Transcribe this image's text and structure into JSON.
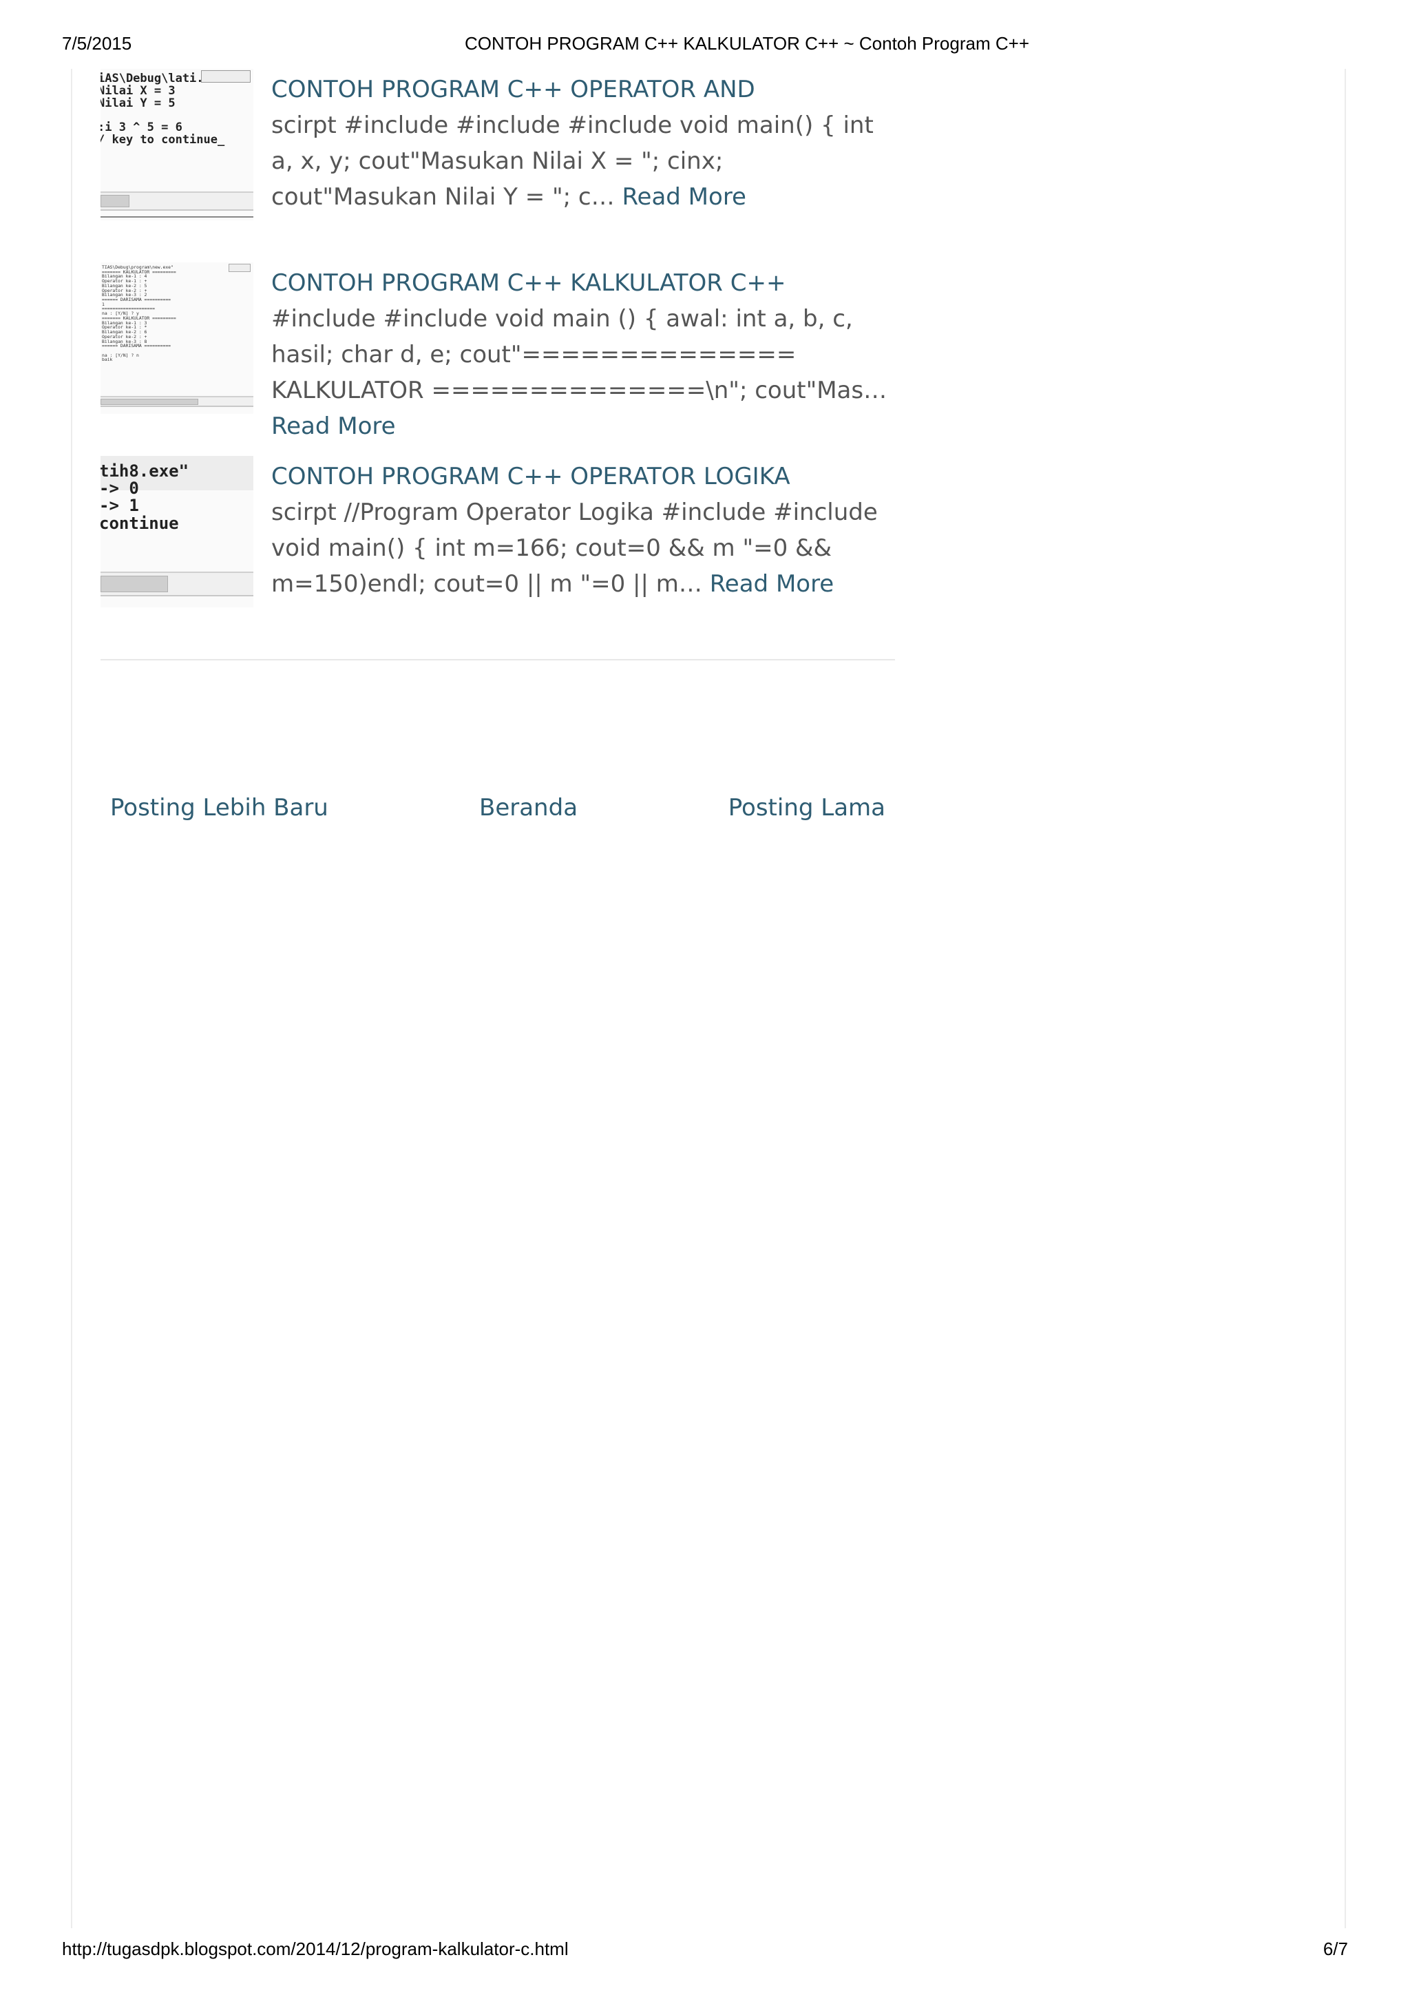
{
  "print_header": {
    "date": "7/5/2015",
    "title": "CONTOH PROGRAM C++ KALKULATOR C++ ~ Contoh Program C++"
  },
  "posts": [
    {
      "title": "CONTOH PROGRAM C++ OPERATOR AND",
      "snippet": "scirpt #include #include #include void main() {  int a, x, y;  cout\"Masukan Nilai X = \";  cinx;  cout\"Masukan Nilai Y = \";  c…",
      "read_more": "Read More",
      "thumb_text": "iAS\\Debug\\lati..\nNilai X = 3\nNilai Y = 5\n\n:i 3 ^ 5 = 6\n/ key to continue_"
    },
    {
      "title": "CONTOH PROGRAM C++ KALKULATOR C++",
      "snippet": "#include #include void main () { awal:     int a, b, c, hasil; char d, e; cout\"============== KALKULATOR ==============\\n\";     cout\"Mas…",
      "read_more": "Read More",
      "thumb_text": "TIAS\\Debug\\program\\new.exe\"\n======= KALKULATOR =========\nBilangan ke-1 : 4\nOperator ke-1 : +\nBilangan ke-2 : 5\nOperator ke-2 : +\nBilangan ke-3 : 2\n====== DARISAMA ==========\n1\n====================\nna : [Y/N] ? y\n======= KALKULATOR =========\nBilangan ke-1 : 3\nOperator ke-1 : *\nBilangan ke-2 : 6\nOperator ke-2 : +\nBilangan ke-3 : 8\n====== DARISAMA ==========\n\nna : [Y/N] ? n\nbaik"
    },
    {
      "title": "CONTOH PROGRAM C++ OPERATOR LOGIKA",
      "snippet": "scirpt //Program Operator Logika #include #include void main() {   int m=166;   cout=0 && m \"=0 && m=150)endl; cout=0 || m \"=0 || m…",
      "read_more": "Read More",
      "thumb_text": "tih8.exe\"\n-> 0\n-> 1\ncontinue"
    }
  ],
  "pager": {
    "newer": "Posting Lebih Baru",
    "home": "Beranda",
    "older": "Posting Lama"
  },
  "print_footer": {
    "url": "http://tugasdpk.blogspot.com/2014/12/program-kalkulator-c.html",
    "page": "6/7"
  },
  "colors": {
    "link": "#2f5d73",
    "body_text": "#555555"
  }
}
